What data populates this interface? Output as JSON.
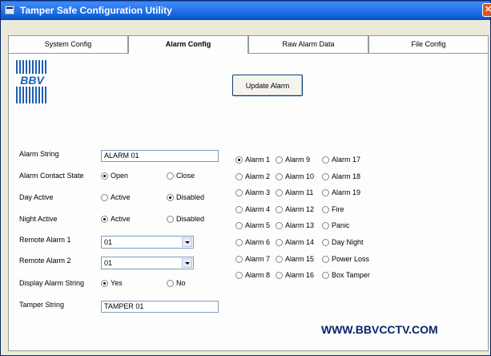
{
  "window": {
    "title": "Tamper Safe Configuration Utility",
    "close_glyph": "✕"
  },
  "tabs": [
    {
      "label": "System Config"
    },
    {
      "label": "Alarm Config"
    },
    {
      "label": "Raw Alarm Data"
    },
    {
      "label": "File Config"
    }
  ],
  "active_tab": "Alarm Config",
  "logo": {
    "text": "BBV"
  },
  "update_button": "Update Alarm",
  "form": {
    "alarm_string": {
      "label": "Alarm String",
      "value": "ALARM  01"
    },
    "contact_state": {
      "label": "Alarm Contact State",
      "options": [
        "Open",
        "Close"
      ],
      "selected": "Open"
    },
    "day_active": {
      "label": "Day Active",
      "options": [
        "Active",
        "Disabled"
      ],
      "selected": "Disabled"
    },
    "night_active": {
      "label": "Night Active",
      "options": [
        "Active",
        "Disabled"
      ],
      "selected": "Active"
    },
    "remote_alarm_1": {
      "label": "Remote Alarm 1",
      "value": "01"
    },
    "remote_alarm_2": {
      "label": "Remote Alarm 2",
      "value": "01"
    },
    "display_alarm_string": {
      "label": "Display Alarm String",
      "options": [
        "Yes",
        "No"
      ],
      "selected": "Yes"
    },
    "tamper_string": {
      "label": "Tamper String",
      "value": "TAMPER 01"
    }
  },
  "alarm_radios": {
    "col1": [
      "Alarm 1",
      "Alarm 2",
      "Alarm 3",
      "Alarm 4",
      "Alarm 5",
      "Alarm 6",
      "Alarm 7",
      "Alarm 8"
    ],
    "col2": [
      "Alarm 9",
      "Alarm 10",
      "Alarm 11",
      "Alarm 12",
      "Alarm 13",
      "Alarm 14",
      "Alarm 15",
      "Alarm 16"
    ],
    "col3": [
      "Alarm 17",
      "Alarm 18",
      "Alarm 19",
      "Fire",
      "Panic",
      "Day Night",
      "Power Loss",
      "Box Tamper"
    ],
    "selected": "Alarm 1"
  },
  "website": "WWW.BBVCCTV.COM",
  "colors": {
    "titlebar": "#0b5ad6",
    "website": "#0a246a",
    "logo_blue": "#1f5fb0"
  }
}
